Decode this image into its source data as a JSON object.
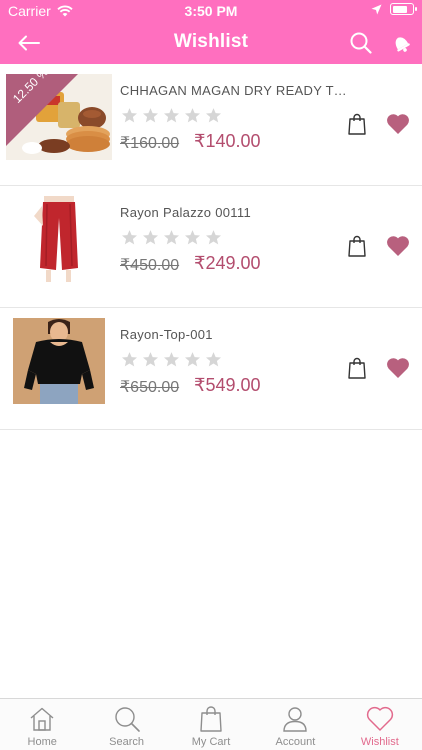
{
  "status_bar": {
    "carrier": "Carrier",
    "time": "3:50 PM",
    "battery_level": 0.8
  },
  "header": {
    "title": "Wishlist",
    "back_icon": "back-arrow-icon",
    "search_icon": "search-icon",
    "notification_icon": "bell-icon"
  },
  "colors": {
    "brand_pink": "#ff6fbf",
    "price": "#b34d6e",
    "heart": "#b8607e",
    "active_tab": "#e26a8d",
    "star_empty": "#d6d6d6"
  },
  "products": [
    {
      "title": "CHHAGAN MAGAN DRY READY TO EAT KHAKHRA",
      "discount_badge": "12.50 %",
      "rating": 0,
      "old_price": "₹160.00",
      "price": "₹140.00",
      "in_wishlist": true
    },
    {
      "title": "Rayon Palazzo 00111",
      "discount_badge": "",
      "rating": 0,
      "old_price": "₹450.00",
      "price": "₹249.00",
      "in_wishlist": true
    },
    {
      "title": "Rayon-Top-001",
      "discount_badge": "",
      "rating": 0,
      "old_price": "₹650.00",
      "price": "₹549.00",
      "in_wishlist": true
    }
  ],
  "tabs": [
    {
      "label": "Home",
      "icon": "home-icon",
      "active": false
    },
    {
      "label": "Search",
      "icon": "search-icon",
      "active": false
    },
    {
      "label": "My Cart",
      "icon": "cart-bag-icon",
      "active": false
    },
    {
      "label": "Account",
      "icon": "user-icon",
      "active": false
    },
    {
      "label": "Wishlist",
      "icon": "heart-icon",
      "active": true
    }
  ]
}
